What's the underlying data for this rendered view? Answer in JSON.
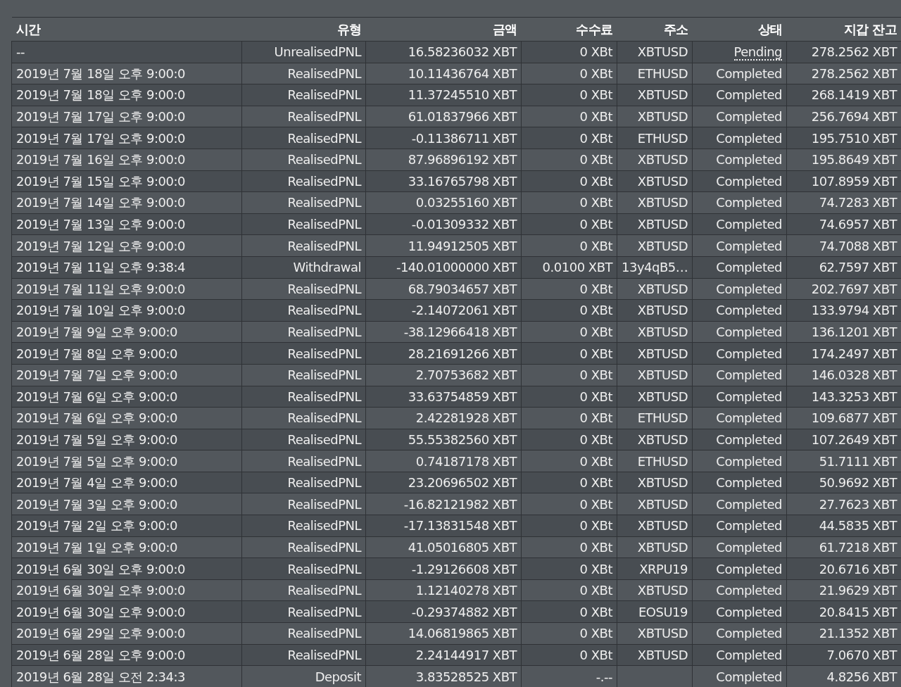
{
  "table": {
    "columns": [
      "시간",
      "유형",
      "금액",
      "수수료",
      "주소",
      "상태",
      "지갑 잔고"
    ],
    "rows": [
      {
        "time": "--",
        "type": "UnrealisedPNL",
        "amount": "16.58236032 XBT",
        "fee": "0 XBt",
        "address": "XBTUSD",
        "status": "Pending",
        "status_hint": true,
        "balance": "278.2562 XBT"
      },
      {
        "time": "2019년 7월 18일 오후 9:00:0",
        "type": "RealisedPNL",
        "amount": "10.11436764 XBT",
        "fee": "0 XBt",
        "address": "ETHUSD",
        "status": "Completed",
        "status_hint": false,
        "balance": "278.2562 XBT"
      },
      {
        "time": "2019년 7월 18일 오후 9:00:0",
        "type": "RealisedPNL",
        "amount": "11.37245510 XBT",
        "fee": "0 XBt",
        "address": "XBTUSD",
        "status": "Completed",
        "status_hint": false,
        "balance": "268.1419 XBT"
      },
      {
        "time": "2019년 7월 17일 오후 9:00:0",
        "type": "RealisedPNL",
        "amount": "61.01837966 XBT",
        "fee": "0 XBt",
        "address": "XBTUSD",
        "status": "Completed",
        "status_hint": false,
        "balance": "256.7694 XBT"
      },
      {
        "time": "2019년 7월 17일 오후 9:00:0",
        "type": "RealisedPNL",
        "amount": "-0.11386711 XBT",
        "fee": "0 XBt",
        "address": "ETHUSD",
        "status": "Completed",
        "status_hint": false,
        "balance": "195.7510 XBT"
      },
      {
        "time": "2019년 7월 16일 오후 9:00:0",
        "type": "RealisedPNL",
        "amount": "87.96896192 XBT",
        "fee": "0 XBt",
        "address": "XBTUSD",
        "status": "Completed",
        "status_hint": false,
        "balance": "195.8649 XBT"
      },
      {
        "time": "2019년 7월 15일 오후 9:00:0",
        "type": "RealisedPNL",
        "amount": "33.16765798 XBT",
        "fee": "0 XBt",
        "address": "XBTUSD",
        "status": "Completed",
        "status_hint": false,
        "balance": "107.8959 XBT"
      },
      {
        "time": "2019년 7월 14일 오후 9:00:0",
        "type": "RealisedPNL",
        "amount": "0.03255160 XBT",
        "fee": "0 XBt",
        "address": "XBTUSD",
        "status": "Completed",
        "status_hint": false,
        "balance": "74.7283 XBT"
      },
      {
        "time": "2019년 7월 13일 오후 9:00:0",
        "type": "RealisedPNL",
        "amount": "-0.01309332 XBT",
        "fee": "0 XBt",
        "address": "XBTUSD",
        "status": "Completed",
        "status_hint": false,
        "balance": "74.6957 XBT"
      },
      {
        "time": "2019년 7월 12일 오후 9:00:0",
        "type": "RealisedPNL",
        "amount": "11.94912505 XBT",
        "fee": "0 XBt",
        "address": "XBTUSD",
        "status": "Completed",
        "status_hint": false,
        "balance": "74.7088 XBT"
      },
      {
        "time": "2019년 7월 11일 오후 9:38:4",
        "type": "Withdrawal",
        "amount": "-140.01000000 XBT",
        "fee": "0.0100 XBT",
        "address": "13y4qB5…",
        "status": "Completed",
        "status_hint": false,
        "balance": "62.7597 XBT"
      },
      {
        "time": "2019년 7월 11일 오후 9:00:0",
        "type": "RealisedPNL",
        "amount": "68.79034657 XBT",
        "fee": "0 XBt",
        "address": "XBTUSD",
        "status": "Completed",
        "status_hint": false,
        "balance": "202.7697 XBT"
      },
      {
        "time": "2019년 7월 10일 오후 9:00:0",
        "type": "RealisedPNL",
        "amount": "-2.14072061 XBT",
        "fee": "0 XBt",
        "address": "XBTUSD",
        "status": "Completed",
        "status_hint": false,
        "balance": "133.9794 XBT"
      },
      {
        "time": "2019년 7월 9일 오후 9:00:0",
        "type": "RealisedPNL",
        "amount": "-38.12966418 XBT",
        "fee": "0 XBt",
        "address": "XBTUSD",
        "status": "Completed",
        "status_hint": false,
        "balance": "136.1201 XBT"
      },
      {
        "time": "2019년 7월 8일 오후 9:00:0",
        "type": "RealisedPNL",
        "amount": "28.21691266 XBT",
        "fee": "0 XBt",
        "address": "XBTUSD",
        "status": "Completed",
        "status_hint": false,
        "balance": "174.2497 XBT"
      },
      {
        "time": "2019년 7월 7일 오후 9:00:0",
        "type": "RealisedPNL",
        "amount": "2.70753682 XBT",
        "fee": "0 XBt",
        "address": "XBTUSD",
        "status": "Completed",
        "status_hint": false,
        "balance": "146.0328 XBT"
      },
      {
        "time": "2019년 7월 6일 오후 9:00:0",
        "type": "RealisedPNL",
        "amount": "33.63754859 XBT",
        "fee": "0 XBt",
        "address": "XBTUSD",
        "status": "Completed",
        "status_hint": false,
        "balance": "143.3253 XBT"
      },
      {
        "time": "2019년 7월 6일 오후 9:00:0",
        "type": "RealisedPNL",
        "amount": "2.42281928 XBT",
        "fee": "0 XBt",
        "address": "ETHUSD",
        "status": "Completed",
        "status_hint": false,
        "balance": "109.6877 XBT"
      },
      {
        "time": "2019년 7월 5일 오후 9:00:0",
        "type": "RealisedPNL",
        "amount": "55.55382560 XBT",
        "fee": "0 XBt",
        "address": "XBTUSD",
        "status": "Completed",
        "status_hint": false,
        "balance": "107.2649 XBT"
      },
      {
        "time": "2019년 7월 5일 오후 9:00:0",
        "type": "RealisedPNL",
        "amount": "0.74187178 XBT",
        "fee": "0 XBt",
        "address": "ETHUSD",
        "status": "Completed",
        "status_hint": false,
        "balance": "51.7111 XBT"
      },
      {
        "time": "2019년 7월 4일 오후 9:00:0",
        "type": "RealisedPNL",
        "amount": "23.20696502 XBT",
        "fee": "0 XBt",
        "address": "XBTUSD",
        "status": "Completed",
        "status_hint": false,
        "balance": "50.9692 XBT"
      },
      {
        "time": "2019년 7월 3일 오후 9:00:0",
        "type": "RealisedPNL",
        "amount": "-16.82121982 XBT",
        "fee": "0 XBt",
        "address": "XBTUSD",
        "status": "Completed",
        "status_hint": false,
        "balance": "27.7623 XBT"
      },
      {
        "time": "2019년 7월 2일 오후 9:00:0",
        "type": "RealisedPNL",
        "amount": "-17.13831548 XBT",
        "fee": "0 XBt",
        "address": "XBTUSD",
        "status": "Completed",
        "status_hint": false,
        "balance": "44.5835 XBT"
      },
      {
        "time": "2019년 7월 1일 오후 9:00:0",
        "type": "RealisedPNL",
        "amount": "41.05016805 XBT",
        "fee": "0 XBt",
        "address": "XBTUSD",
        "status": "Completed",
        "status_hint": false,
        "balance": "61.7218 XBT"
      },
      {
        "time": "2019년 6월 30일 오후 9:00:0",
        "type": "RealisedPNL",
        "amount": "-1.29126608 XBT",
        "fee": "0 XBt",
        "address": "XRPU19",
        "status": "Completed",
        "status_hint": false,
        "balance": "20.6716 XBT"
      },
      {
        "time": "2019년 6월 30일 오후 9:00:0",
        "type": "RealisedPNL",
        "amount": "1.12140278 XBT",
        "fee": "0 XBt",
        "address": "XBTUSD",
        "status": "Completed",
        "status_hint": false,
        "balance": "21.9629 XBT"
      },
      {
        "time": "2019년 6월 30일 오후 9:00:0",
        "type": "RealisedPNL",
        "amount": "-0.29374882 XBT",
        "fee": "0 XBt",
        "address": "EOSU19",
        "status": "Completed",
        "status_hint": false,
        "balance": "20.8415 XBT"
      },
      {
        "time": "2019년 6월 29일 오후 9:00:0",
        "type": "RealisedPNL",
        "amount": "14.06819865 XBT",
        "fee": "0 XBt",
        "address": "XBTUSD",
        "status": "Completed",
        "status_hint": false,
        "balance": "21.1352 XBT"
      },
      {
        "time": "2019년 6월 28일 오후 9:00:0",
        "type": "RealisedPNL",
        "amount": "2.24144917 XBT",
        "fee": "0 XBt",
        "address": "XBTUSD",
        "status": "Completed",
        "status_hint": false,
        "balance": "7.0670 XBT"
      },
      {
        "time": "2019년 6월 28일 오전 2:34:3",
        "type": "Deposit",
        "amount": "3.83528525 XBT",
        "fee": "-.--",
        "status": "Completed",
        "status_hint": false,
        "balance": "4.8256 XBT"
      }
    ]
  }
}
